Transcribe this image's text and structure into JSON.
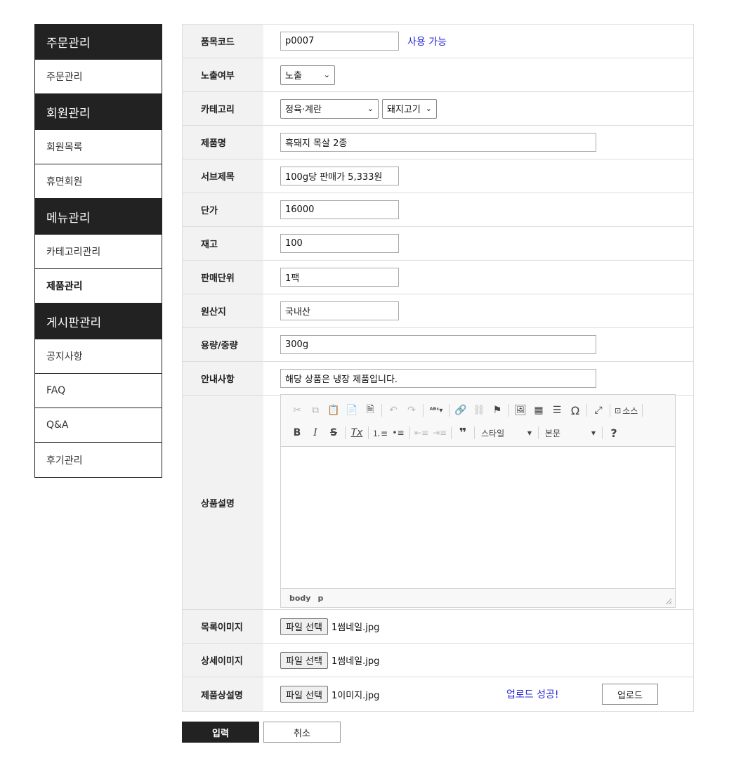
{
  "sidebar": {
    "groups": [
      {
        "title": "주문관리",
        "items": [
          "주문관리"
        ]
      },
      {
        "title": "회원관리",
        "items": [
          "회원목록",
          "휴면회원"
        ]
      },
      {
        "title": "메뉴관리",
        "items": [
          "카테고리관리",
          "제품관리"
        ]
      },
      {
        "title": "게시판관리",
        "items": [
          "공지사항",
          "FAQ",
          "Q&A",
          "후기관리"
        ]
      }
    ],
    "active_item": "제품관리"
  },
  "form": {
    "code": {
      "label": "품목코드",
      "value": "p0007",
      "status": "사용 가능"
    },
    "display": {
      "label": "노출여부",
      "selected": "노출"
    },
    "category": {
      "label": "카테고리",
      "main_selected": "정육·계란",
      "sub_selected": "돼지고기"
    },
    "name": {
      "label": "제품명",
      "value": "흑돼지 목살 2종"
    },
    "subtitle": {
      "label": "서브제목",
      "value": "100g당 판매가 5,333원"
    },
    "price": {
      "label": "단가",
      "value": "16000"
    },
    "stock": {
      "label": "재고",
      "value": "100"
    },
    "unit": {
      "label": "판매단위",
      "value": "1팩"
    },
    "origin": {
      "label": "원산지",
      "value": "국내산"
    },
    "weight": {
      "label": "용량/중량",
      "value": "300g"
    },
    "notice": {
      "label": "안내사항",
      "value": "해당 상품은 냉장 제품입니다."
    },
    "description": {
      "label": "상품설명",
      "toolbar": {
        "source_label": "소스",
        "style_combo": "스타일",
        "format_combo": "본문"
      },
      "status_path": [
        "body",
        "p"
      ]
    },
    "list_image": {
      "label": "목록이미지",
      "button": "파일 선택",
      "file": "1썸네일.jpg"
    },
    "detail_image": {
      "label": "상세이미지",
      "button": "파일 선택",
      "file": "1썸네일.jpg"
    },
    "desc_image": {
      "label": "제품상설명",
      "button": "파일 선택",
      "file": "1이미지.jpg",
      "upload_status": "업로드 성공!",
      "upload_button": "업로드"
    }
  },
  "actions": {
    "submit": "입력",
    "cancel": "취소"
  },
  "colors": {
    "sidebar_header": "#222222",
    "label_bg": "#f2f2f2",
    "accent_text": "#2727d6"
  }
}
